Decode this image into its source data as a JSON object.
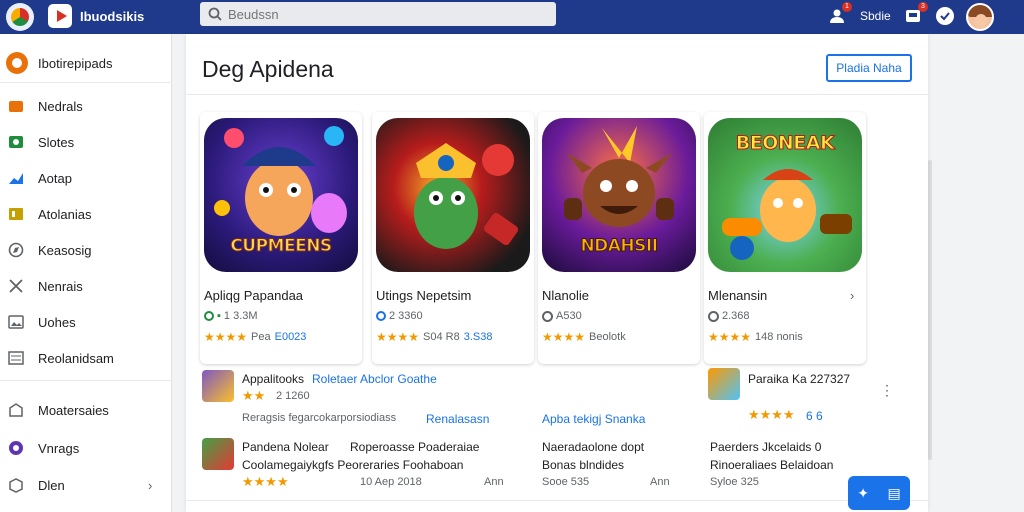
{
  "topbar": {
    "brand_title": "Ibuodsikis",
    "search_placeholder": "Beudssn",
    "user_label": "Sbdie",
    "notif_count_1": "1",
    "notif_count_2": "3",
    "bg_color": "#1f3a8a"
  },
  "sidebar": {
    "items": [
      {
        "label": "Ibotirepipads",
        "icon": "app-logo-icon",
        "color": "#e8710a"
      },
      {
        "label": "Nedrals",
        "icon": "store-icon",
        "color": "#e8710a"
      },
      {
        "label": "Slotes",
        "icon": "game-icon",
        "color": "#1e8e3e"
      },
      {
        "label": "Aotap",
        "icon": "chart-icon",
        "color": "#1a73e8"
      },
      {
        "label": "Atolanias",
        "icon": "book-icon",
        "color": "#c5a000"
      },
      {
        "label": "Keasosig",
        "icon": "compass-icon",
        "color": "#5f6368"
      },
      {
        "label": "Nenrais",
        "icon": "tools-icon",
        "color": "#5f6368"
      },
      {
        "label": "Uohes",
        "icon": "image-icon",
        "color": "#5f6368"
      },
      {
        "label": "Reolanidsam",
        "icon": "list-icon",
        "color": "#5f6368"
      },
      {
        "label": "Moatersaies",
        "icon": "building-icon",
        "color": "#5f6368"
      },
      {
        "label": "Vnrags",
        "icon": "circle-icon",
        "color": "#5e35b1"
      },
      {
        "label": "Dlen",
        "icon": "box-icon",
        "color": "#5f6368"
      }
    ]
  },
  "main": {
    "title": "Deg Apidena",
    "action_button": "Pladia Naha",
    "cards": [
      {
        "title": "Apliqg Papandaa",
        "meta": "1 3.3M",
        "stars": "★★★★",
        "rating_text": "Pea",
        "price": "E0023",
        "art_text": "CUPMEENS"
      },
      {
        "title": "Utings Nepetsim",
        "meta": "2 3360",
        "stars": "★★★★",
        "rating_text": "S04 R8",
        "price": "3.S38",
        "art_text": ""
      },
      {
        "title": "Nlanolie",
        "meta": "A530",
        "stars": "★★★★",
        "rating_text": "Beolotk",
        "price": "",
        "art_text": "NDAHSII"
      },
      {
        "title": "Mlenansin",
        "meta": "2.368",
        "stars": "★★★★",
        "rating_text": "148 nonis",
        "price": "",
        "art_text": "BEONEAK"
      }
    ],
    "list": [
      {
        "title": "Appalitooks",
        "link": "Roletaer Abclor Goathe",
        "sub": "2 1260",
        "extra": "Reragsis fegarcokarporsiodiass",
        "extra_link": "Renalasasn",
        "stars": "★★"
      },
      {
        "title": "Pandena Nolear",
        "link": "",
        "sub": "",
        "extra": "Coolamegaiykgfs Peoreraries Foohaboan",
        "extra2": "Roperoasse Poaderaiae",
        "date": "10 Aep 2018",
        "stars": "★★★★"
      },
      {
        "title": "Apba tekigj Snanka",
        "link": "",
        "sub": ""
      },
      {
        "title": "Naeradaolone dopt",
        "sub2": "Bonas blndides",
        "date": "Sooe 535",
        "time": "Ann"
      },
      {
        "title": "Paraika Ka 227327",
        "stars": "★★★★",
        "rating": "6 6",
        "kebab": "⋮"
      },
      {
        "title": "Paerders Jkcelaids 0",
        "sub2": "Rinoeraliaes Belaidoan",
        "date": "Syloe 325"
      }
    ],
    "time_label": "Ann"
  },
  "fab": {
    "label": "✦ 目"
  }
}
